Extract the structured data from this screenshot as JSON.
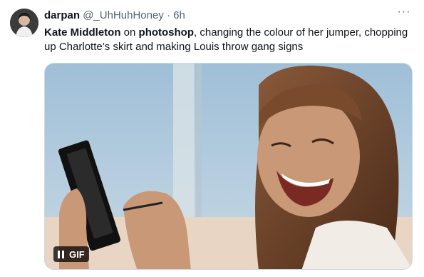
{
  "user": {
    "name": "darpan",
    "handle": "@_UhHuhHoney",
    "separator": "·",
    "time": "6h"
  },
  "more_label": "···",
  "tweet": {
    "part1": "Kate Middleton",
    "part2": " on ",
    "part3": "photoshop",
    "part4": ", changing the colour of her jumper, chopping up  Charlotte’s skirt and making Louis throw gang signs"
  },
  "media": {
    "badge_label": "GIF"
  },
  "colors": {
    "text": "#0f1419",
    "secondary": "#536471",
    "border": "#cfd9de"
  }
}
